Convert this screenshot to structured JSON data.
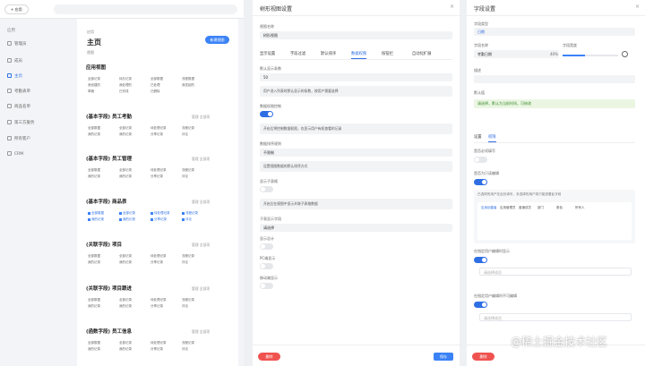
{
  "app": {
    "add_button": "+ 应用",
    "nav_title": "应用",
    "nav_items": [
      {
        "label": "管理员",
        "active": false,
        "icon": "grid-icon"
      },
      {
        "label": "成员",
        "active": false,
        "icon": "user-icon"
      },
      {
        "label": "主页",
        "active": true,
        "icon": "home-icon"
      },
      {
        "label": "考勤表单",
        "active": false,
        "icon": "calendar-icon"
      },
      {
        "label": "商品名单",
        "active": false,
        "icon": "box-icon"
      },
      {
        "label": "第三方服务",
        "active": false,
        "icon": "plug-icon"
      },
      {
        "label": "所有客户",
        "active": false,
        "icon": "people-icon"
      },
      {
        "label": "CRM",
        "active": false,
        "icon": "chart-icon"
      }
    ],
    "panel": {
      "breadcrumb": "应用",
      "title": "主页",
      "new_button": "新建视图",
      "sub_label": "视图",
      "sections": [
        {
          "title": "应用视图",
          "actions": "",
          "rows": [
            [
              "全部记录",
              "待办记录",
              "全部数据",
              "流程数据"
            ],
            [
              "我创建的",
              "我处理的",
              "已处理",
              "我发起的"
            ],
            [
              "草稿",
              "已完成",
              "已删除",
              ""
            ]
          ],
          "checked": false
        },
        {
          "title": "(基本字段) 员工考勤",
          "actions": "管理   全部项",
          "rows": [
            [
              "全部数据",
              "全部记录",
              "待处理记录",
              "流程记录"
            ],
            [
              "我的记录",
              "我的记录",
              "分享记录",
              "评论"
            ]
          ],
          "checked": false
        },
        {
          "title": "(基本字段) 员工管理",
          "actions": "管理   全部项",
          "rows": [
            [
              "全部数据",
              "全部记录",
              "待处理记录",
              "流程记录"
            ],
            [
              "我的记录",
              "我的记录",
              "分享记录",
              "评论"
            ]
          ],
          "checked": false
        },
        {
          "title": "(基本字段) 商品表",
          "actions": "管理   全部项",
          "rows": [
            [
              "全部数据",
              "全部记录",
              "待处理记录",
              "流程记录"
            ],
            [
              "我的记录",
              "我的记录",
              "分享记录",
              "评论"
            ]
          ],
          "checked": true
        },
        {
          "title": "(关联字段) 项目",
          "actions": "管理   全部项",
          "rows": [
            [
              "全部数据",
              "全部记录",
              "待处理记录",
              "流程记录"
            ],
            [
              "我的记录",
              "我的记录",
              "分享记录",
              "评论"
            ]
          ],
          "checked": false
        },
        {
          "title": "(关联字段) 项目跟进",
          "actions": "管理   全部项",
          "rows": [
            [
              "全部数据",
              "全部记录",
              "待处理记录",
              "流程记录"
            ],
            [
              "我的记录",
              "我的记录",
              "分享记录",
              "评论"
            ]
          ],
          "checked": false
        },
        {
          "title": "(函数字段) 员工信息",
          "actions": "管理   全部项",
          "rows": [
            [
              "全部数据",
              "全部记录",
              "待处理记录",
              "流程记录"
            ],
            [
              "我的记录",
              "我的记录",
              "分享记录",
              "评论"
            ]
          ],
          "checked": false
        }
      ]
    }
  },
  "mid": {
    "title": "树形视图设置",
    "close": "×",
    "name_label": "视图名称",
    "name_value": "树形视图",
    "tabs": [
      "显示设置",
      "字段过滤",
      "默认排序",
      "数据权限",
      "按钮栏",
      "自动化扩展"
    ],
    "active_tab": 3,
    "fields": [
      {
        "label": "默认显示条数",
        "value": "50"
      },
      {
        "note": "用户进入列表时默认显示的条数，按用户需要选择"
      },
      {
        "label": "数据权限控制",
        "toggle": true
      },
      {
        "note": "开启后将控制数据权限，仅显示用户有权查看的记录"
      },
      {
        "label": "数据排序规则",
        "value": "不限制"
      },
      {
        "note": "设置视图数据的默认排序方式"
      },
      {
        "label": "显示子表格",
        "toggle": false
      },
      {
        "note": "开启后在视图中显示关联子表格数据"
      },
      {
        "label": "子表显示字段",
        "value": "请选择"
      },
      {
        "label": "显示总计",
        "toggle": false
      },
      {
        "label": "PC端显示",
        "toggle": false
      },
      {
        "label": "移动端显示",
        "toggle": false
      }
    ],
    "delete": "删除",
    "ok": "保存"
  },
  "right": {
    "title": "字段设置",
    "close": "×",
    "type_label": "字段类型",
    "type_value": "日期",
    "name_label": "字段名称",
    "name_value": "考勤日期",
    "width_label": "字段宽度",
    "width_value": "40%",
    "desc_label": "描述",
    "default_label": "默认值",
    "hint": "请选择，默认为当前时间，可修改",
    "tabs": [
      "设置",
      "权限"
    ],
    "active_tab": 1,
    "perm1_label": "是否必须填写",
    "perm2_label": "是否为只读编辑",
    "note": "已选择的用户在此处填写，未选择的用户将只能查看此字段",
    "roles": [
      "应用创建者",
      "应用管理员",
      "普通成员",
      "部门",
      "角色",
      "所有人"
    ],
    "perm3_label": "在指定用户编辑时显示",
    "perm3_value": "请选择成员",
    "perm4_label": "在指定用户编辑时不可编辑",
    "perm4_value": "请选择成员",
    "delete": "删除"
  },
  "watermark": "@稀土掘金技术社区"
}
